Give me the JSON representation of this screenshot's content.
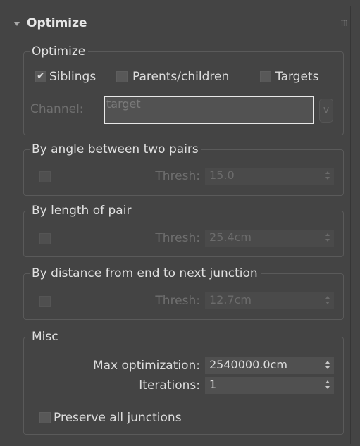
{
  "rollout": {
    "title": "Optimize"
  },
  "optimize_group": {
    "legend": "Optimize",
    "siblings": {
      "label": "Siblings",
      "checked": true
    },
    "parents_children": {
      "label": "Parents/children",
      "checked": false
    },
    "targets": {
      "label": "Targets",
      "checked": false
    },
    "channel": {
      "label": "Channel:",
      "value": "target",
      "button": "v"
    }
  },
  "angle_group": {
    "legend": "By angle between two pairs",
    "thresh_label": "Thresh:",
    "thresh_value": "15.0"
  },
  "length_group": {
    "legend": "By length of pair",
    "thresh_label": "Thresh:",
    "thresh_value": "25.4cm"
  },
  "distance_group": {
    "legend": "By distance from end to next junction",
    "thresh_label": "Thresh:",
    "thresh_value": "12.7cm"
  },
  "misc_group": {
    "legend": "Misc",
    "max_optimization": {
      "label": "Max optimization:",
      "value": "2540000.0cm"
    },
    "iterations": {
      "label": "Iterations:",
      "value": "1"
    },
    "preserve": {
      "label": "Preserve all junctions",
      "checked": false
    }
  }
}
